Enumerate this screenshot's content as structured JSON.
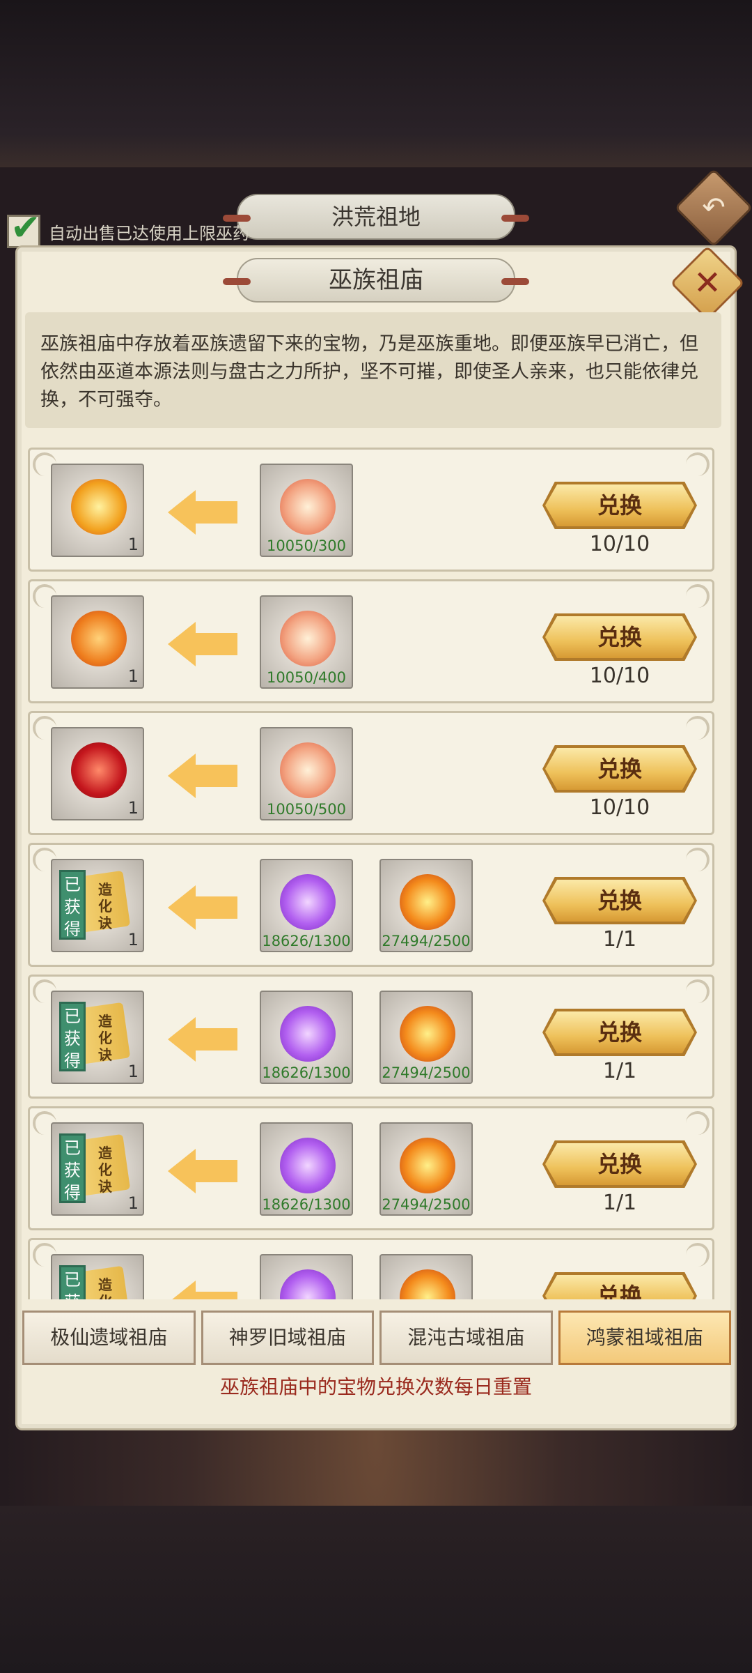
{
  "outer": {
    "title": "洪荒祖地",
    "auto_sell_label": "自动出售已达使用上限巫药"
  },
  "panel": {
    "title": "巫族祖庙",
    "description": "巫族祖庙中存放着巫族遗留下来的宝物，乃是巫族重地。即便巫族早已消亡，但依然由巫道本源法则与盘古之力所护，坚不可摧，即使圣人亲来，也只能依律兑换，不可强夺。"
  },
  "rows": [
    {
      "reward_icon": "gold-treasure-icon",
      "reward_count": "1",
      "cost1": "10050/300",
      "button": "兑换",
      "limit": "10/10"
    },
    {
      "reward_icon": "orange-treasure-icon",
      "reward_count": "1",
      "cost1": "10050/400",
      "button": "兑换",
      "limit": "10/10"
    },
    {
      "reward_icon": "red-treasure-icon",
      "reward_count": "1",
      "cost1": "10050/500",
      "button": "兑换",
      "limit": "10/10"
    },
    {
      "reward_icon": "scroll-book-icon",
      "reward_count": "1",
      "obtained": "已获得",
      "book_title": "造化诀",
      "cost1": "18626/1300",
      "cost2": "27494/2500",
      "button": "兑换",
      "limit": "1/1"
    },
    {
      "reward_icon": "scroll-book-icon",
      "reward_count": "1",
      "obtained": "已获得",
      "book_title": "造化诀",
      "cost1": "18626/1300",
      "cost2": "27494/2500",
      "button": "兑换",
      "limit": "1/1"
    },
    {
      "reward_icon": "scroll-book-icon",
      "reward_count": "1",
      "obtained": "已获得",
      "book_title": "造化诀",
      "cost1": "18626/1300",
      "cost2": "27494/2500",
      "button": "兑换",
      "limit": "1/1"
    },
    {
      "reward_icon": "scroll-book-icon",
      "obtained": "已获",
      "book_title": "造化诀",
      "button": "兑换"
    }
  ],
  "tabs": [
    "极仙遗域祖庙",
    "神罗旧域祖庙",
    "混沌古域祖庙",
    "鸿蒙祖域祖庙"
  ],
  "active_tab": "鸿蒙祖域祖庙",
  "footer_note": "巫族祖庙中的宝物兑换次数每日重置",
  "colors": {
    "accent_gold": "#eec15a",
    "note_red": "#9a2a1e",
    "cost_green": "#2f7a2a",
    "obtained_green": "#3f8f6e"
  }
}
